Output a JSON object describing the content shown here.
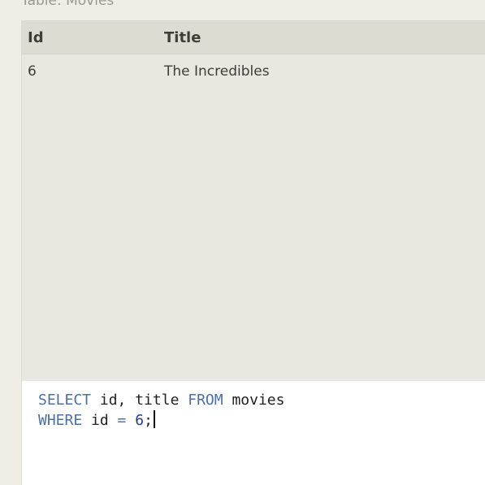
{
  "caption": "Table: Movies",
  "results": {
    "columns": [
      "Id",
      "Title"
    ],
    "rows": [
      {
        "id": "6",
        "title": "The Incredibles"
      }
    ]
  },
  "editor": {
    "line1": {
      "kw_select": "SELECT",
      "fields": " id, title ",
      "kw_from": "FROM",
      "table": " movies"
    },
    "line2": {
      "kw_where": "WHERE",
      "cond": " id ",
      "op": "=",
      "space": " ",
      "value": "6",
      "end": ";"
    }
  },
  "colors": {
    "keyword": "#4b6fa6",
    "number": "#1e3aa0",
    "header_bg": "#dddcd3",
    "panel_bg": "#e8e7e0"
  }
}
